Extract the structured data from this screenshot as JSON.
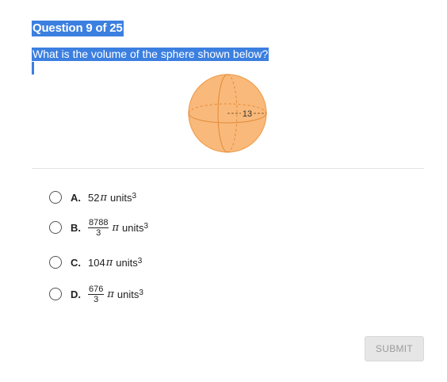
{
  "question": {
    "number_label": "Question 9 of 25",
    "prompt": "What is the volume of the sphere shown below?"
  },
  "figure": {
    "radius_label": "13",
    "sphere_color": "#f9b97a",
    "sphere_stroke": "#f0a050"
  },
  "options": [
    {
      "letter": "A.",
      "coef": "52",
      "pi": "π",
      "unit": "units",
      "exp": "3"
    },
    {
      "letter": "B.",
      "numerator": "8788",
      "denominator": "3",
      "pi": "π",
      "unit": "units",
      "exp": "3"
    },
    {
      "letter": "C.",
      "coef": "104",
      "pi": "π",
      "unit": "units",
      "exp": "3"
    },
    {
      "letter": "D.",
      "numerator": "676",
      "denominator": "3",
      "pi": "π",
      "unit": "units",
      "exp": "3"
    }
  ],
  "submit_label": "SUBMIT"
}
